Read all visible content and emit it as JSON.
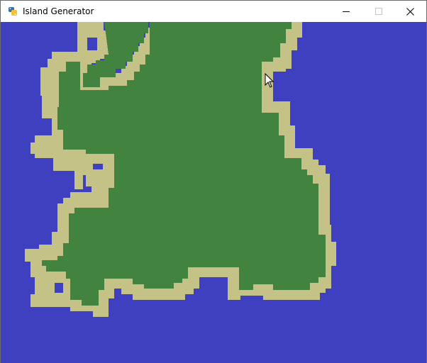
{
  "window": {
    "title": "Island Generator",
    "icon": "python-icon",
    "buttons": {
      "minimize": "minimize-icon",
      "maximize": "maximize-icon",
      "close": "close-icon"
    }
  },
  "map": {
    "colors": {
      "water": "#3f40c0",
      "sand": "#c5c287",
      "land": "#428340"
    }
  }
}
